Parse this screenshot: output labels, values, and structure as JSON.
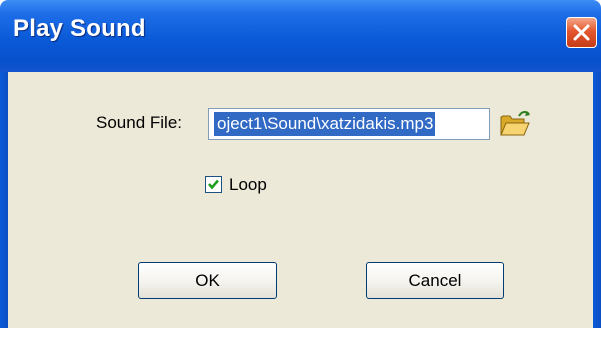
{
  "window": {
    "title": "Play Sound",
    "close_icon": "close-icon"
  },
  "form": {
    "sound_file_label": "Sound File:",
    "sound_file_value": "oject1\\Sound\\xatzidakis.mp3",
    "sound_file_selected": true,
    "browse_icon": "folder-open-icon",
    "loop_label": "Loop",
    "loop_checked": true
  },
  "buttons": {
    "ok_label": "OK",
    "cancel_label": "Cancel"
  },
  "colors": {
    "titlebar": "#0a5ad8",
    "close_button": "#e4572e",
    "client_background": "#ece9d8",
    "selection": "#316ac5",
    "button_border": "#003c74"
  }
}
